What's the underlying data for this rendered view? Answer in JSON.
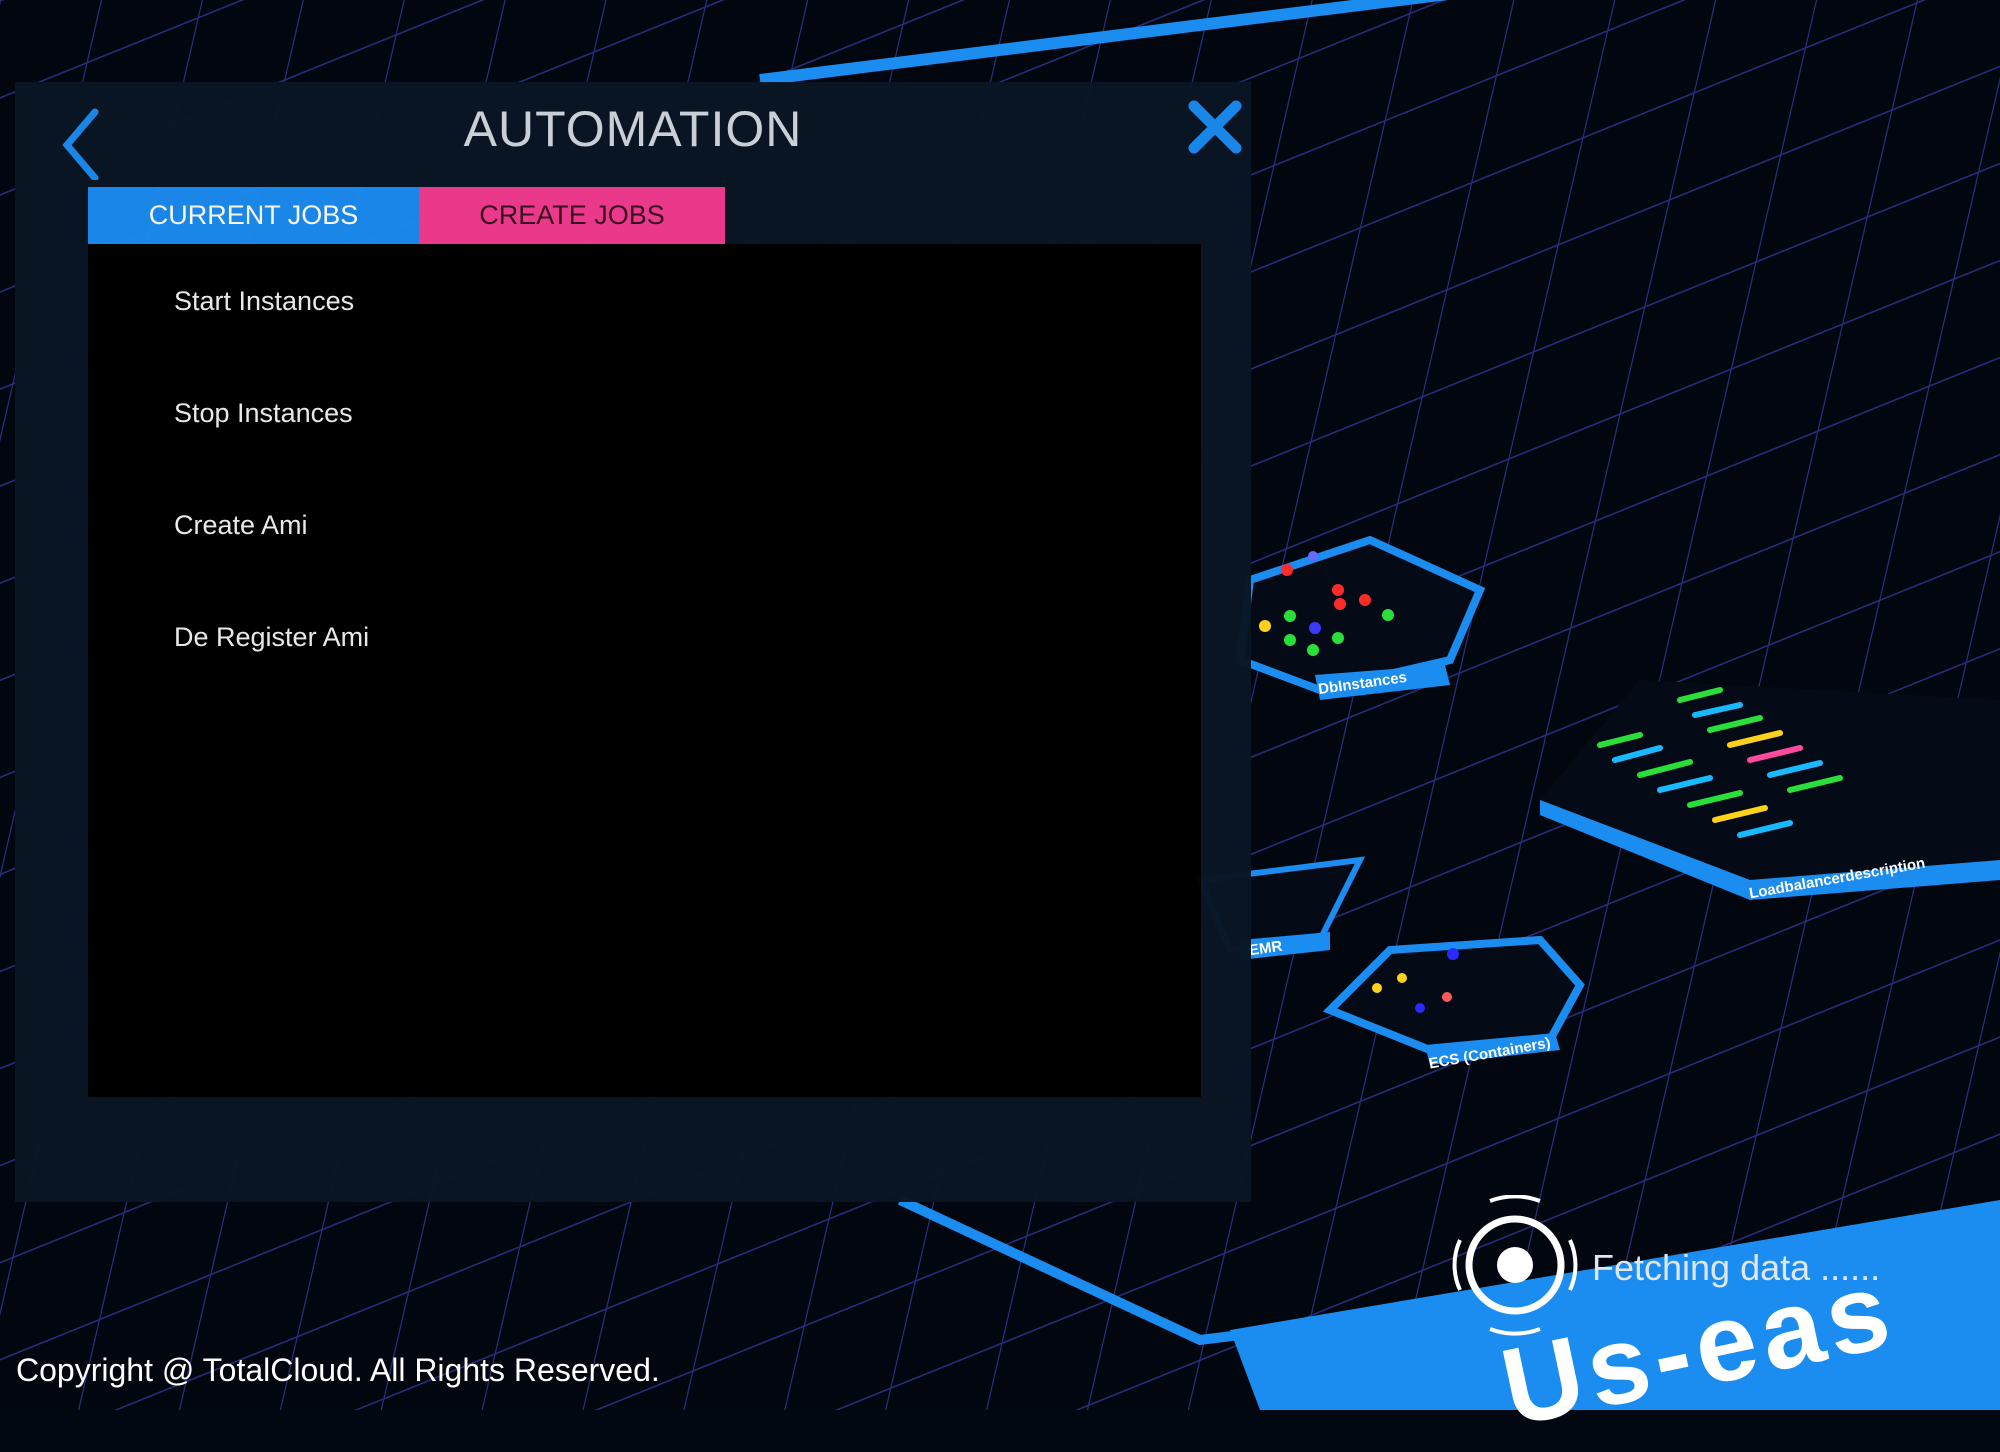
{
  "window": {
    "title": "AUTOMATION"
  },
  "tabs": [
    {
      "label": "CURRENT JOBS",
      "active": true
    },
    {
      "label": "CREATE JOBS",
      "active": false
    }
  ],
  "jobs": [
    {
      "label": "Start Instances"
    },
    {
      "label": "Stop Instances"
    },
    {
      "label": "Create Ami"
    },
    {
      "label": "De Register Ami"
    }
  ],
  "scene": {
    "nodes": [
      {
        "label": "DbInstances"
      },
      {
        "label": "Loadbalancerdescription"
      },
      {
        "label": "EMR"
      },
      {
        "label": "ECS (Containers)"
      }
    ],
    "status_text": "Fetching data ......",
    "region_label": "Us-eas"
  },
  "footer": {
    "copyright": "Copyright @ TotalCloud. All Rights Reserved."
  },
  "colors": {
    "accent_blue": "#1b8cf0",
    "accent_pink": "#f23b8f",
    "grid": "#2a2f7a",
    "background": "#020812"
  },
  "icons": {
    "back": "chevron-left-icon",
    "close": "close-icon",
    "loader": "loading-ring-icon"
  }
}
